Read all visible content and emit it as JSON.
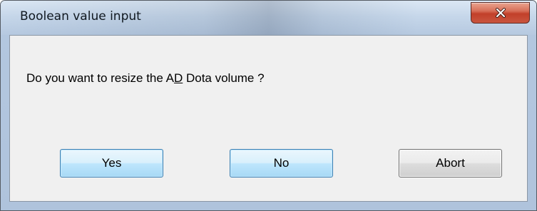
{
  "window": {
    "title": "Boolean value input"
  },
  "dialog": {
    "message_prefix": "Do you want to resize the A",
    "message_mnemonic": "D",
    "message_suffix": " Dota volume ?"
  },
  "buttons": {
    "yes_label": "Yes",
    "no_label": "No",
    "abort_label": "Abort"
  },
  "icons": {
    "close": "close-icon"
  },
  "colors": {
    "titlebar": "#c6d7ea",
    "close_button": "#c2402a",
    "content_background": "#f0f0f0",
    "focused_button": "#bee6fd"
  }
}
